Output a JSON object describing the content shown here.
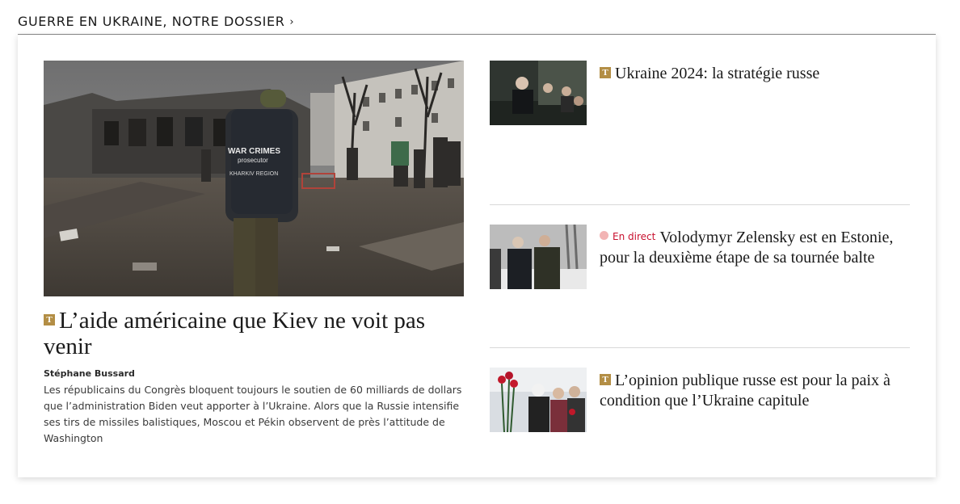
{
  "section": {
    "title": "GUERRE EN UKRAINE, NOTRE DOSSIER",
    "chevron": "›"
  },
  "lead": {
    "badge": "T",
    "title": "L’aide américaine que Kiev ne voit pas venir",
    "author": "Stéphane Bussard",
    "description": "Les républicains du Congrès bloquent toujours le soutien de 60 milliards de dollars que l’administration Biden veut apporter à l’Ukraine. Alors que la Russie intensifie ses tirs de missiles balistiques, Moscou et Pékin observent de près l’attitude de Washington",
    "image_vest": [
      "WAR CRIMES",
      "prosecutor",
      "KHARKIV REGION"
    ]
  },
  "side_articles": [
    {
      "badge": "T",
      "title": "Ukraine 2024: la stratégie russe"
    },
    {
      "live_label": "En direct",
      "title": "Volodymyr Zelensky est en Estonie, pour la deuxième étape de sa tournée balte"
    },
    {
      "badge": "T",
      "title": "L’opinion publique russe est pour la paix à condition que l’Ukraine capitule"
    }
  ],
  "colors": {
    "badge": "#b38e45",
    "live_dot": "#f2b4b4",
    "live_text": "#c8102e"
  }
}
